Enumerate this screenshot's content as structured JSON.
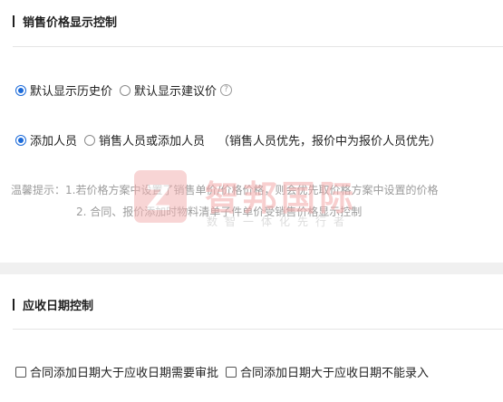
{
  "price_section": {
    "title": "销售价格显示控制",
    "radio_group_1": {
      "options": [
        "默认显示历史价",
        "默认显示建议价"
      ],
      "help_icon": "question-circle-icon"
    },
    "radio_group_2": {
      "options": [
        "添加人员",
        "销售人员或添加人员"
      ],
      "note": "（销售人员优先，报价中为报价人员优先）"
    },
    "tips": {
      "line1": "温馨提示：1.若价格方案中设置了销售单价/价格价格，则会优先取价格方案中设置的价格",
      "line2": "2. 合同、报价添加时物料清单子件单价受销售价格显示控制"
    }
  },
  "receivable_section": {
    "title": "应收日期控制",
    "checkboxes": [
      "合同添加日期大于应收日期需要审批",
      "合同添加日期大于应收日期不能录入"
    ]
  },
  "watermark": {
    "logo_letter": "Z",
    "title": "智邦国际",
    "subtitle": "数智一体化先行者"
  },
  "colors": {
    "accent": "#1b6ad9",
    "tip_text": "#9b9b9b",
    "watermark": "#f3a9a9"
  }
}
